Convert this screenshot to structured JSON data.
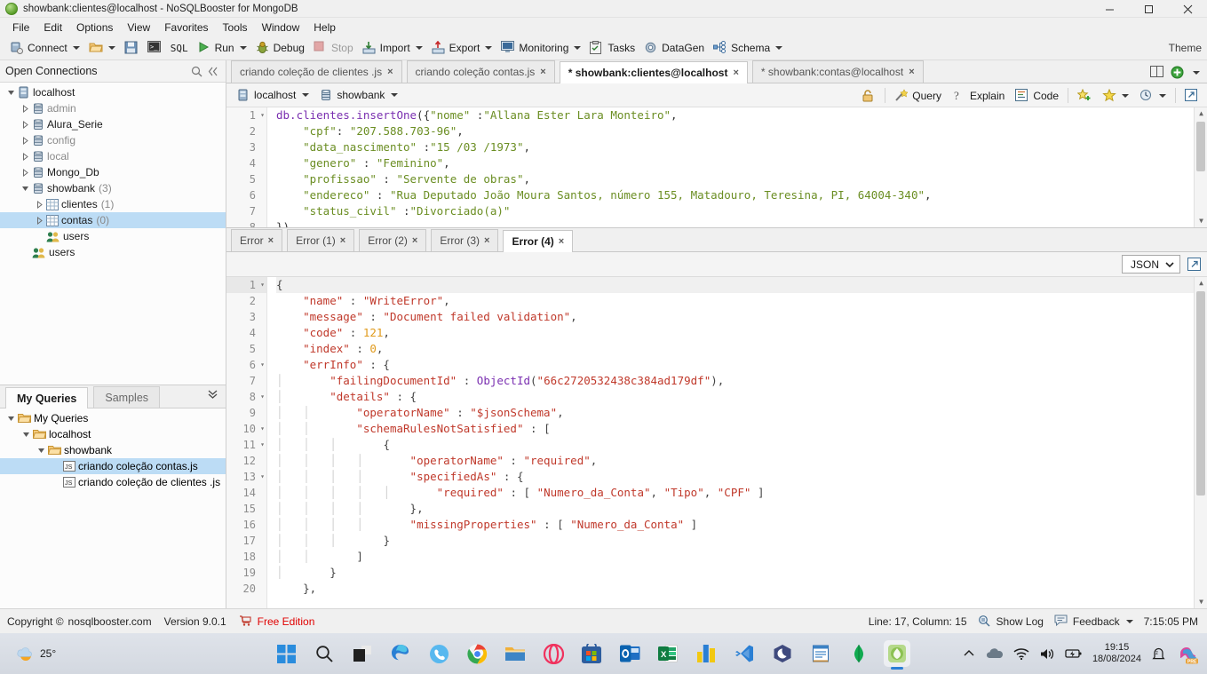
{
  "window": {
    "title": "showbank:clientes@localhost - NoSQLBooster for MongoDB",
    "app_icon": "mongodb-leaf-icon",
    "minimize": "minimize-button",
    "maximize": "maximize-button",
    "close": "close-button"
  },
  "menubar": {
    "items": [
      "File",
      "Edit",
      "Options",
      "View",
      "Favorites",
      "Tools",
      "Window",
      "Help"
    ]
  },
  "toolbar": {
    "connect": "Connect",
    "sql": "SQL",
    "run": "Run",
    "debug": "Debug",
    "stop": "Stop",
    "import": "Import",
    "export": "Export",
    "monitoring": "Monitoring",
    "tasks": "Tasks",
    "datagen": "DataGen",
    "schema": "Schema",
    "theme": "Theme"
  },
  "connections_panel": {
    "title": "Open Connections",
    "search_icon": "search-icon",
    "collapse_icon": "collapse-icon",
    "tree": [
      {
        "label": "localhost",
        "icon": "server-icon",
        "depth": 0,
        "expanded": true,
        "dim": false,
        "count": ""
      },
      {
        "label": "admin",
        "icon": "database-icon",
        "depth": 1,
        "expanded": false,
        "dim": true,
        "count": ""
      },
      {
        "label": "Alura_Serie",
        "icon": "database-icon",
        "depth": 1,
        "expanded": false,
        "dim": false,
        "count": ""
      },
      {
        "label": "config",
        "icon": "database-icon",
        "depth": 1,
        "expanded": false,
        "dim": true,
        "count": ""
      },
      {
        "label": "local",
        "icon": "database-icon",
        "depth": 1,
        "expanded": false,
        "dim": true,
        "count": ""
      },
      {
        "label": "Mongo_Db",
        "icon": "database-icon",
        "depth": 1,
        "expanded": false,
        "dim": false,
        "count": ""
      },
      {
        "label": "showbank",
        "icon": "database-icon",
        "depth": 1,
        "expanded": true,
        "dim": false,
        "count": "(3)"
      },
      {
        "label": "clientes",
        "icon": "collection-icon",
        "depth": 2,
        "expanded": false,
        "dim": false,
        "count": "(1)"
      },
      {
        "label": "contas",
        "icon": "collection-icon",
        "depth": 2,
        "expanded": false,
        "dim": false,
        "count": "(0)",
        "selected": true
      },
      {
        "label": "users",
        "icon": "users-icon",
        "depth": 2,
        "leaf": true,
        "dim": false,
        "count": ""
      },
      {
        "label": "users",
        "icon": "users-icon",
        "depth": 1,
        "leaf": true,
        "dim": false,
        "count": ""
      }
    ]
  },
  "queries_panel": {
    "tabs": [
      {
        "label": "My Queries",
        "active": true
      },
      {
        "label": "Samples",
        "active": false
      }
    ],
    "expand_icon": "chevron-double-down-icon",
    "tree": [
      {
        "label": "My Queries",
        "icon": "folder-icon",
        "depth": 0,
        "expanded": true
      },
      {
        "label": "localhost",
        "icon": "folder-icon",
        "depth": 1,
        "expanded": true
      },
      {
        "label": "showbank",
        "icon": "folder-icon",
        "depth": 2,
        "expanded": true
      },
      {
        "label": "criando coleção contas.js",
        "icon": "js-file-icon",
        "depth": 3,
        "leaf": true,
        "selected": true
      },
      {
        "label": "criando coleção de clientes .js",
        "icon": "js-file-icon",
        "depth": 3,
        "leaf": true
      }
    ]
  },
  "editor_tabs": {
    "items": [
      {
        "label": "criando coleção de clientes .js",
        "active": false,
        "close": "×"
      },
      {
        "label": "criando coleção contas.js",
        "active": false,
        "close": "×"
      },
      {
        "label": "* showbank:clientes@localhost",
        "active": true,
        "close": "×"
      },
      {
        "label": "* showbank:contas@localhost",
        "active": false,
        "close": "×"
      }
    ],
    "split_icon": "split-view-icon",
    "new_icon": "new-tab-icon",
    "new_caret": "chevron-down-icon"
  },
  "connection_bar": {
    "host": "localhost",
    "database": "showbank",
    "host_icon": "server-icon",
    "db_icon": "database-icon",
    "lock_icon": "lock-icon",
    "query_label": "Query",
    "query_icon": "wand-icon",
    "explain_label": "Explain",
    "explain_icon": "question-icon",
    "code_label": "Code",
    "code_icon": "code-icon",
    "add_favorite_icon": "star-plus-icon",
    "favorites_icon": "star-icon",
    "history_icon": "history-icon",
    "popout_icon": "popout-icon"
  },
  "code_editor": {
    "lines": [
      {
        "n": "1",
        "fold": "▾",
        "tokens": [
          {
            "t": "db.clientes.insertOne",
            "c": "fn"
          },
          {
            "t": "({",
            "c": "plain"
          },
          {
            "t": "\"nome\"",
            "c": "str"
          },
          {
            "t": " :",
            "c": "plain"
          },
          {
            "t": "\"Allana Ester Lara Monteiro\"",
            "c": "str"
          },
          {
            "t": ",",
            "c": "plain"
          }
        ]
      },
      {
        "n": "2",
        "fold": "",
        "tokens": [
          {
            "t": "    ",
            "c": "plain"
          },
          {
            "t": "\"cpf\"",
            "c": "str"
          },
          {
            "t": ": ",
            "c": "plain"
          },
          {
            "t": "\"207.588.703-96\"",
            "c": "str"
          },
          {
            "t": ",",
            "c": "plain"
          }
        ]
      },
      {
        "n": "3",
        "fold": "",
        "tokens": [
          {
            "t": "    ",
            "c": "plain"
          },
          {
            "t": "\"data_nascimento\"",
            "c": "str"
          },
          {
            "t": " :",
            "c": "plain"
          },
          {
            "t": "\"15 /03 /1973\"",
            "c": "str"
          },
          {
            "t": ",",
            "c": "plain"
          }
        ]
      },
      {
        "n": "4",
        "fold": "",
        "tokens": [
          {
            "t": "    ",
            "c": "plain"
          },
          {
            "t": "\"genero\"",
            "c": "str"
          },
          {
            "t": " : ",
            "c": "plain"
          },
          {
            "t": "\"Feminino\"",
            "c": "str"
          },
          {
            "t": ",",
            "c": "plain"
          }
        ]
      },
      {
        "n": "5",
        "fold": "",
        "tokens": [
          {
            "t": "    ",
            "c": "plain"
          },
          {
            "t": "\"profissao\"",
            "c": "str"
          },
          {
            "t": " : ",
            "c": "plain"
          },
          {
            "t": "\"Servente de obras\"",
            "c": "str"
          },
          {
            "t": ",",
            "c": "plain"
          }
        ]
      },
      {
        "n": "6",
        "fold": "",
        "tokens": [
          {
            "t": "    ",
            "c": "plain"
          },
          {
            "t": "\"endereco\"",
            "c": "str"
          },
          {
            "t": " : ",
            "c": "plain"
          },
          {
            "t": "\"Rua Deputado João Moura Santos, número 155, Matadouro, Teresina, PI, 64004-340\"",
            "c": "str"
          },
          {
            "t": ",",
            "c": "plain"
          }
        ]
      },
      {
        "n": "7",
        "fold": "",
        "tokens": [
          {
            "t": "    ",
            "c": "plain"
          },
          {
            "t": "\"status_civil\"",
            "c": "str"
          },
          {
            "t": " :",
            "c": "plain"
          },
          {
            "t": "\"Divorciado(a)\"",
            "c": "str"
          }
        ]
      },
      {
        "n": "8",
        "fold": "",
        "tokens": [
          {
            "t": "})",
            "c": "plain"
          }
        ]
      }
    ]
  },
  "result_tabs": {
    "items": [
      {
        "label": "Error",
        "active": false,
        "close": "×"
      },
      {
        "label": "Error (1)",
        "active": false,
        "close": "×"
      },
      {
        "label": "Error (2)",
        "active": false,
        "close": "×"
      },
      {
        "label": "Error (3)",
        "active": false,
        "close": "×"
      },
      {
        "label": "Error (4)",
        "active": true,
        "close": "×"
      }
    ]
  },
  "result_toolbar": {
    "view_mode": "JSON",
    "view_caret": "chevron-down-icon",
    "popout_icon": "popout-icon"
  },
  "result_editor": {
    "lines": [
      {
        "n": "1",
        "fold": "▾",
        "indent": 0,
        "tokens": [
          {
            "t": "{",
            "c": "punct"
          }
        ]
      },
      {
        "n": "2",
        "fold": "",
        "indent": 0,
        "tokens": [
          {
            "t": "    ",
            "c": "punct"
          },
          {
            "t": "\"name\"",
            "c": "key"
          },
          {
            "t": " : ",
            "c": "punct"
          },
          {
            "t": "\"WriteError\"",
            "c": "str"
          },
          {
            "t": ",",
            "c": "punct"
          }
        ]
      },
      {
        "n": "3",
        "fold": "",
        "indent": 0,
        "tokens": [
          {
            "t": "    ",
            "c": "punct"
          },
          {
            "t": "\"message\"",
            "c": "key"
          },
          {
            "t": " : ",
            "c": "punct"
          },
          {
            "t": "\"Document failed validation\"",
            "c": "str"
          },
          {
            "t": ",",
            "c": "punct"
          }
        ]
      },
      {
        "n": "4",
        "fold": "",
        "indent": 0,
        "tokens": [
          {
            "t": "    ",
            "c": "punct"
          },
          {
            "t": "\"code\"",
            "c": "key"
          },
          {
            "t": " : ",
            "c": "punct"
          },
          {
            "t": "121",
            "c": "num"
          },
          {
            "t": ",",
            "c": "punct"
          }
        ]
      },
      {
        "n": "5",
        "fold": "",
        "indent": 0,
        "tokens": [
          {
            "t": "    ",
            "c": "punct"
          },
          {
            "t": "\"index\"",
            "c": "key"
          },
          {
            "t": " : ",
            "c": "punct"
          },
          {
            "t": "0",
            "c": "num"
          },
          {
            "t": ",",
            "c": "punct"
          }
        ]
      },
      {
        "n": "6",
        "fold": "▾",
        "indent": 0,
        "tokens": [
          {
            "t": "    ",
            "c": "punct"
          },
          {
            "t": "\"errInfo\"",
            "c": "key"
          },
          {
            "t": " : ",
            "c": "punct"
          },
          {
            "t": "{",
            "c": "punct"
          }
        ]
      },
      {
        "n": "7",
        "fold": "",
        "indent": 1,
        "tokens": [
          {
            "t": "\"failingDocumentId\"",
            "c": "key"
          },
          {
            "t": " : ",
            "c": "punct"
          },
          {
            "t": "ObjectId",
            "c": "obj"
          },
          {
            "t": "(",
            "c": "punct"
          },
          {
            "t": "\"66c2720532438c384ad179df\"",
            "c": "str"
          },
          {
            "t": "),",
            "c": "punct"
          }
        ]
      },
      {
        "n": "8",
        "fold": "▾",
        "indent": 1,
        "tokens": [
          {
            "t": "\"details\"",
            "c": "key"
          },
          {
            "t": " : ",
            "c": "punct"
          },
          {
            "t": "{",
            "c": "punct"
          }
        ]
      },
      {
        "n": "9",
        "fold": "",
        "indent": 2,
        "tokens": [
          {
            "t": "\"operatorName\"",
            "c": "key"
          },
          {
            "t": " : ",
            "c": "punct"
          },
          {
            "t": "\"$jsonSchema\"",
            "c": "str"
          },
          {
            "t": ",",
            "c": "punct"
          }
        ]
      },
      {
        "n": "10",
        "fold": "▾",
        "indent": 2,
        "tokens": [
          {
            "t": "\"schemaRulesNotSatisfied\"",
            "c": "key"
          },
          {
            "t": " : ",
            "c": "punct"
          },
          {
            "t": "[",
            "c": "punct"
          }
        ]
      },
      {
        "n": "11",
        "fold": "▾",
        "indent": 3,
        "tokens": [
          {
            "t": "{",
            "c": "punct"
          }
        ]
      },
      {
        "n": "12",
        "fold": "",
        "indent": 4,
        "tokens": [
          {
            "t": "\"operatorName\"",
            "c": "key"
          },
          {
            "t": " : ",
            "c": "punct"
          },
          {
            "t": "\"required\"",
            "c": "str"
          },
          {
            "t": ",",
            "c": "punct"
          }
        ]
      },
      {
        "n": "13",
        "fold": "▾",
        "indent": 4,
        "tokens": [
          {
            "t": "\"specifiedAs\"",
            "c": "key"
          },
          {
            "t": " : ",
            "c": "punct"
          },
          {
            "t": "{",
            "c": "punct"
          }
        ]
      },
      {
        "n": "14",
        "fold": "",
        "indent": 5,
        "tokens": [
          {
            "t": "\"required\"",
            "c": "key"
          },
          {
            "t": " : [ ",
            "c": "punct"
          },
          {
            "t": "\"Numero_da_Conta\"",
            "c": "str"
          },
          {
            "t": ", ",
            "c": "punct"
          },
          {
            "t": "\"Tipo\"",
            "c": "str"
          },
          {
            "t": ", ",
            "c": "punct"
          },
          {
            "t": "\"CPF\"",
            "c": "str"
          },
          {
            "t": " ]",
            "c": "punct"
          }
        ]
      },
      {
        "n": "15",
        "fold": "",
        "indent": 4,
        "tokens": [
          {
            "t": "},",
            "c": "punct"
          }
        ]
      },
      {
        "n": "16",
        "fold": "",
        "indent": 4,
        "tokens": [
          {
            "t": "\"missingProperties\"",
            "c": "key"
          },
          {
            "t": " : [ ",
            "c": "punct"
          },
          {
            "t": "\"Numero_da_Conta\"",
            "c": "str"
          },
          {
            "t": " ]",
            "c": "punct"
          }
        ]
      },
      {
        "n": "17",
        "fold": "",
        "indent": 3,
        "tokens": [
          {
            "t": "}",
            "c": "punct"
          }
        ]
      },
      {
        "n": "18",
        "fold": "",
        "indent": 2,
        "tokens": [
          {
            "t": "]",
            "c": "punct"
          }
        ]
      },
      {
        "n": "19",
        "fold": "",
        "indent": 1,
        "tokens": [
          {
            "t": "}",
            "c": "punct"
          }
        ]
      },
      {
        "n": "20",
        "fold": "",
        "indent": 0,
        "tokens": [
          {
            "t": "    },",
            "c": "punct"
          }
        ]
      }
    ]
  },
  "statusbar": {
    "copyright": "Copyright ©",
    "site": "nosqlbooster.com",
    "version": "Version 9.0.1",
    "edition": "Free Edition",
    "cart_icon": "cart-icon",
    "position": "Line: 17, Column: 15",
    "show_log": "Show Log",
    "show_log_icon": "log-icon",
    "feedback": "Feedback",
    "feedback_icon": "chat-icon",
    "feedback_caret": "chevron-down-icon",
    "time": "7:15:05 PM"
  },
  "taskbar": {
    "weather_temp": "25°",
    "weather_icon": "partly-sunny-icon",
    "apps": [
      {
        "name": "start-button"
      },
      {
        "name": "search-button"
      },
      {
        "name": "task-view-button"
      },
      {
        "name": "edge-icon"
      },
      {
        "name": "phone-link-icon"
      },
      {
        "name": "chrome-icon"
      },
      {
        "name": "file-explorer-icon"
      },
      {
        "name": "opera-icon"
      },
      {
        "name": "microsoft-store-icon"
      },
      {
        "name": "outlook-icon"
      },
      {
        "name": "excel-icon"
      },
      {
        "name": "power-bi-icon"
      },
      {
        "name": "vscode-icon"
      },
      {
        "name": "insomnia-icon"
      },
      {
        "name": "notepad-icon"
      },
      {
        "name": "mongodb-compass-icon"
      },
      {
        "name": "nosqlbooster-icon"
      }
    ],
    "tray": {
      "chevron_icon": "show-hidden-icons",
      "onedrive_icon": "onedrive-icon",
      "wifi_icon": "wifi-icon",
      "volume_icon": "volume-icon",
      "battery_icon": "battery-icon",
      "notifications_icon": "notifications-icon",
      "copilot_icon": "copilot-icon",
      "copilot_badge": "PRE"
    },
    "clock": {
      "time": "19:15",
      "date": "18/08/2024"
    }
  }
}
